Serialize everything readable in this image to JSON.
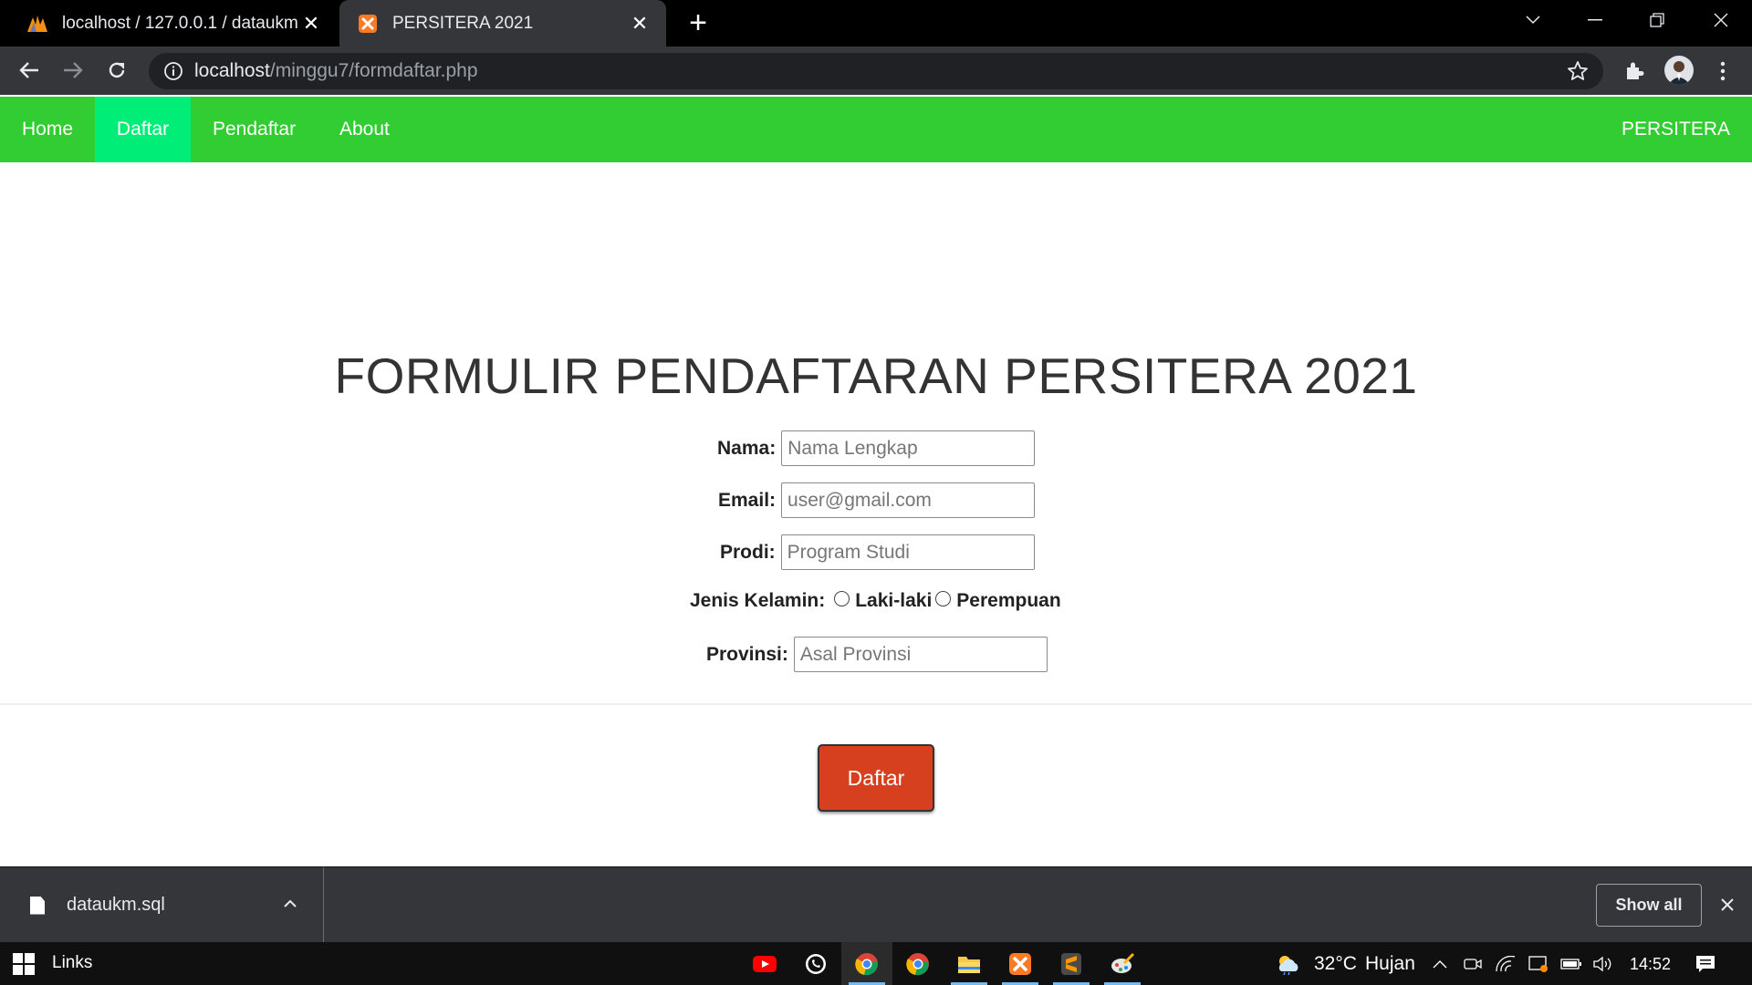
{
  "browser": {
    "tabs": [
      {
        "title": "localhost / 127.0.0.1 / dataukm | ",
        "favicon": "phpmyadmin-icon",
        "active": false
      },
      {
        "title": "PERSITERA 2021",
        "favicon": "xampp-icon",
        "active": true
      }
    ],
    "new_tab_icon": "plus-icon",
    "url_host": "localhost",
    "url_path": "/minggu7/formdaftar.php"
  },
  "nav": {
    "items": [
      "Home",
      "Daftar",
      "Pendaftar",
      "About"
    ],
    "active": "Daftar",
    "brand": "PERSITERA",
    "color": "#32cd32",
    "active_color": "#00ee77"
  },
  "form": {
    "title": "FORMULIR PENDAFTARAN PERSITERA 2021",
    "nama": {
      "label": "Nama:",
      "placeholder": "Nama Lengkap"
    },
    "email": {
      "label": "Email:",
      "placeholder": "user@gmail.com"
    },
    "prodi": {
      "label": "Prodi:",
      "placeholder": "Program Studi"
    },
    "gender": {
      "label": "Jenis Kelamin:",
      "options": [
        "Laki-laki",
        "Perempuan"
      ]
    },
    "provinsi": {
      "label": "Provinsi:",
      "placeholder": "Asal Provinsi"
    },
    "submit_label": "Daftar",
    "submit_color": "#d6401f"
  },
  "downloads": {
    "file_name": "dataukm.sql",
    "show_all_label": "Show all"
  },
  "taskbar": {
    "links_label": "Links",
    "weather": {
      "temperature": "32°C",
      "condition": "Hujan"
    },
    "time": "14:52"
  }
}
